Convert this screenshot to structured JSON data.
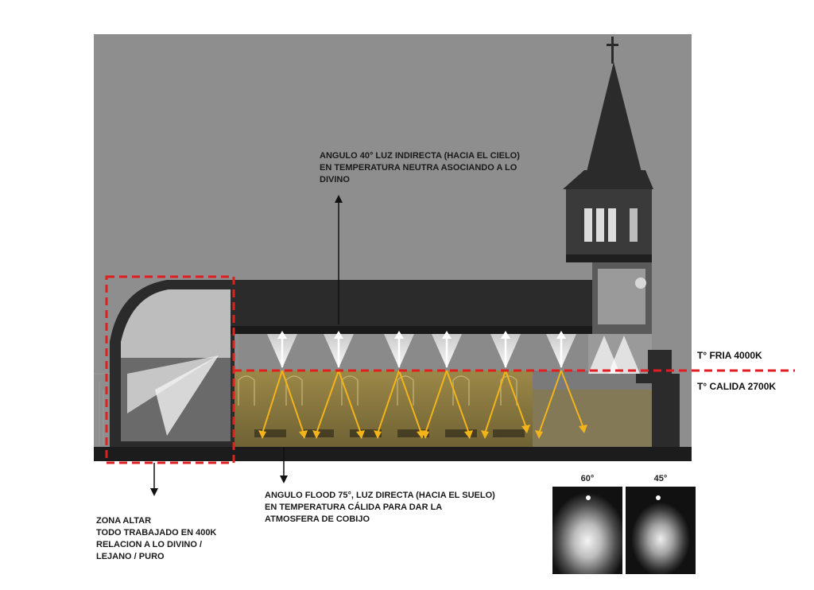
{
  "annotations": {
    "top": {
      "lines": [
        "ANGULO 40° LUZ INDIRECTA (HACIA EL CIELO)",
        "EN TEMPERATURA NEUTRA ASOCIANDO A LO",
        "DIVINO"
      ]
    },
    "bottom": {
      "lines": [
        "ANGULO FLOOD 75°, LUZ DIRECTA (HACIA EL SUELO)",
        "EN TEMPERATURA CÁLIDA PARA DAR LA",
        "ATMOSFERA DE COBIJO"
      ]
    },
    "altar": {
      "lines": [
        "ZONA ALTAR",
        "TODO TRABAJADO EN 400K",
        "RELACION A LO DIVINO /",
        "LEJANO / PURO"
      ]
    }
  },
  "temperature": {
    "cold": "T° FRIA 4000K",
    "warm": "T° CALIDA 2700K"
  },
  "beam_samples": [
    {
      "label": "60°"
    },
    {
      "label": "45°"
    }
  ],
  "colors": {
    "sky": "#8e8e8e",
    "building": "#2b2b2b",
    "warm_zone": "#8a7a45",
    "warm_arrow": "#f2b41a",
    "up_arrow": "#ffffff",
    "dashed_line": "#e0201c"
  }
}
